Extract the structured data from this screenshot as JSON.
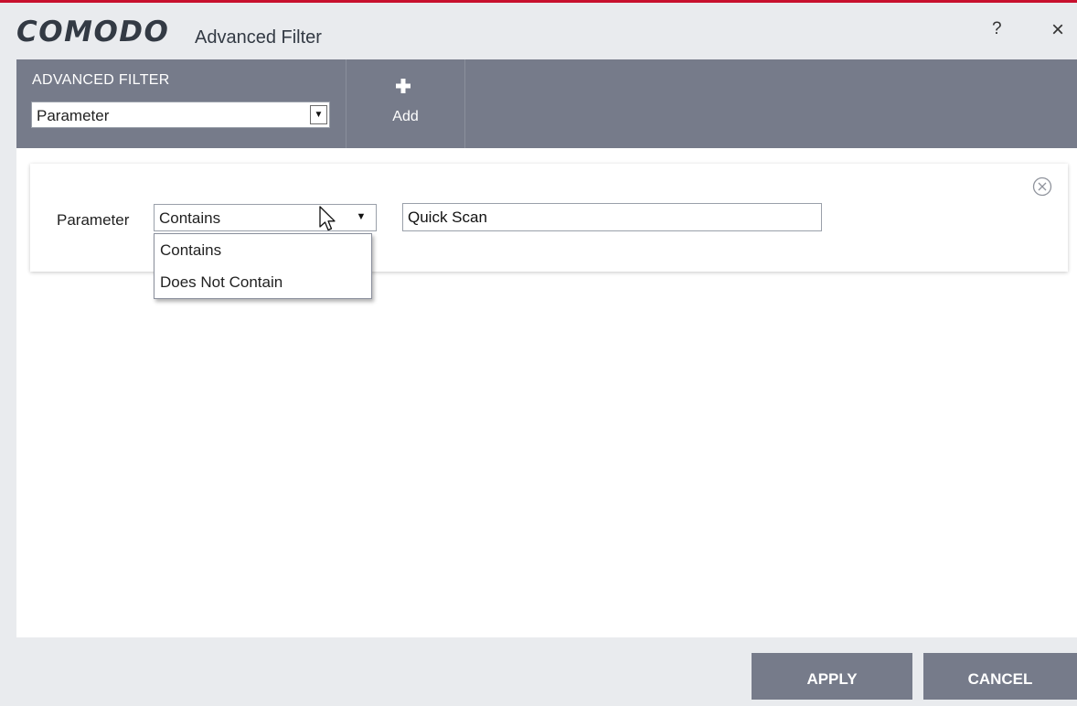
{
  "window": {
    "brand": "COMODO",
    "title": "Advanced Filter",
    "help_label": "?",
    "close_label": "×"
  },
  "toolbar": {
    "section_label": "ADVANCED FILTER",
    "filter_select_value": "Parameter",
    "add_label": "Add"
  },
  "filter": {
    "parameter_label": "Parameter",
    "condition_value": "Contains",
    "condition_options": [
      "Contains",
      "Does Not Contain"
    ],
    "value": "Quick Scan"
  },
  "footer": {
    "apply_label": "APPLY",
    "cancel_label": "CANCEL"
  },
  "colors": {
    "accent_red": "#c8102e",
    "toolbar_bg": "#767b8a",
    "window_bg": "#e9ebee",
    "button_bg": "#767b8a"
  },
  "icons": {
    "add": "plus-icon",
    "remove_filter": "circle-x-icon",
    "dropdown": "triangle-down-icon",
    "pointer": "mouse-cursor-icon"
  }
}
